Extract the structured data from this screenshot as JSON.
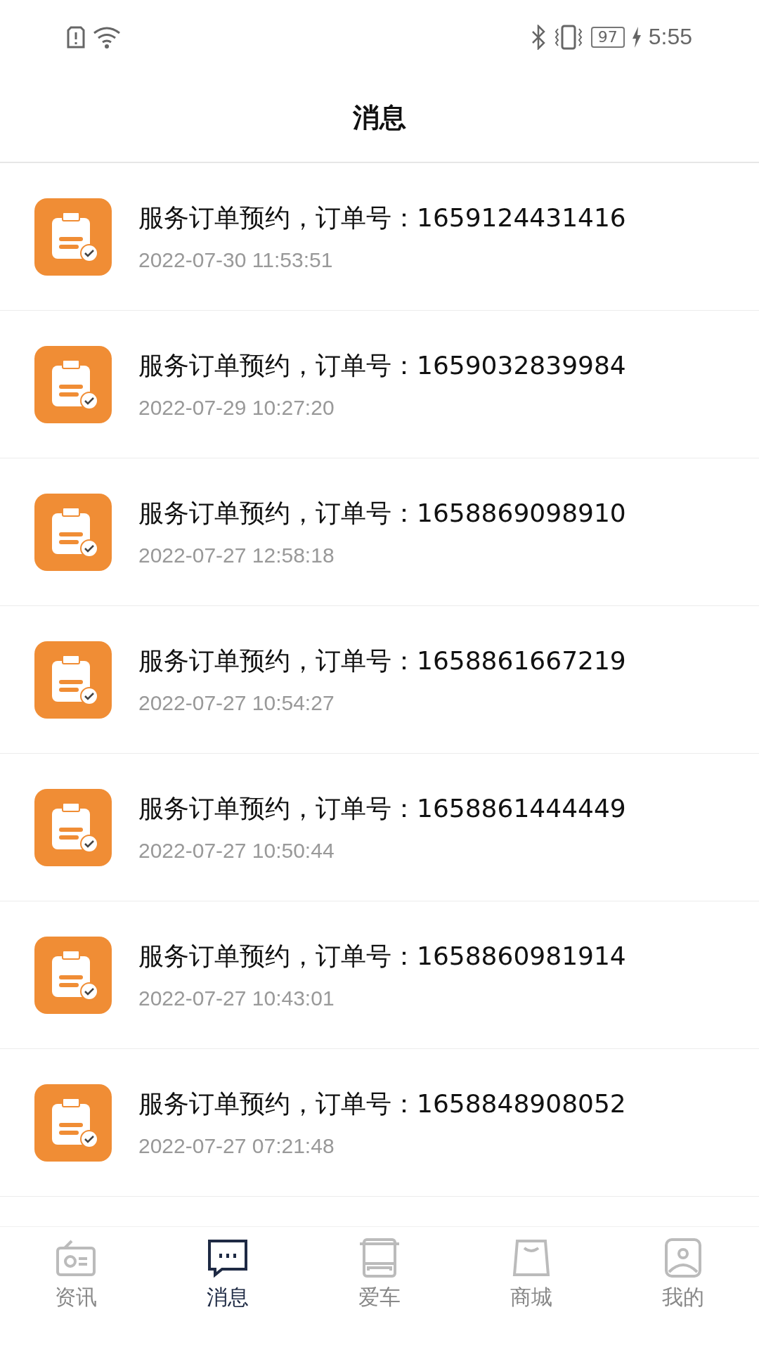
{
  "status_bar": {
    "battery": "97",
    "time": "5:55"
  },
  "header": {
    "title": "消息"
  },
  "messages": [
    {
      "title": "服务订单预约，订单号：1659124431416",
      "time": "2022-07-30 11:53:51"
    },
    {
      "title": "服务订单预约，订单号：1659032839984",
      "time": "2022-07-29 10:27:20"
    },
    {
      "title": "服务订单预约，订单号：1658869098910",
      "time": "2022-07-27 12:58:18"
    },
    {
      "title": "服务订单预约，订单号：1658861667219",
      "time": "2022-07-27 10:54:27"
    },
    {
      "title": "服务订单预约，订单号：1658861444449",
      "time": "2022-07-27 10:50:44"
    },
    {
      "title": "服务订单预约，订单号：1658860981914",
      "time": "2022-07-27 10:43:01"
    },
    {
      "title": "服务订单预约，订单号：1658848908052",
      "time": "2022-07-27 07:21:48"
    }
  ],
  "tab_bar": [
    {
      "kind": "news",
      "label": "资讯",
      "selected": false
    },
    {
      "kind": "messages",
      "label": "消息",
      "selected": true
    },
    {
      "kind": "car",
      "label": "爱车",
      "selected": false
    },
    {
      "kind": "mall",
      "label": "商城",
      "selected": false
    },
    {
      "kind": "profile",
      "label": "我的",
      "selected": false
    }
  ]
}
